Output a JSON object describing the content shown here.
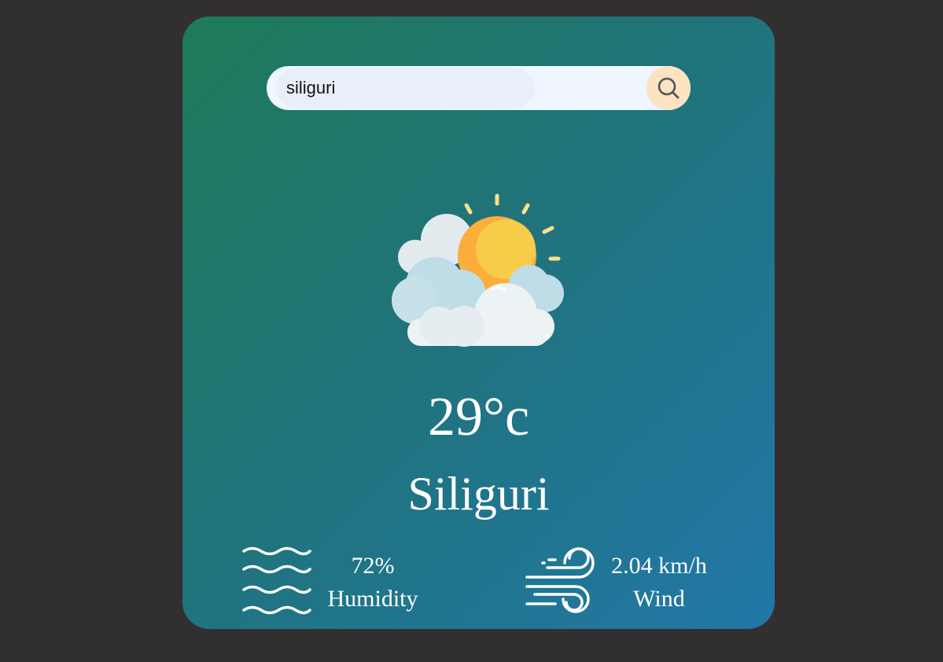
{
  "search": {
    "value": "siliguri",
    "button_icon": "search-icon"
  },
  "weather": {
    "icon": "partly-cloudy-icon",
    "temperature": "29°c",
    "city": "Siliguri"
  },
  "details": {
    "humidity": {
      "icon": "humidity-icon",
      "value": "72%",
      "label": "Humidity"
    },
    "wind": {
      "icon": "wind-icon",
      "value": "2.04 km/h",
      "label": "Wind"
    }
  },
  "colors": {
    "page_background": "#312f30",
    "card_gradient_start": "#1f7a58",
    "card_gradient_end": "#2178a8",
    "search_background": "#eff6fd",
    "search_button": "#fde3c2"
  }
}
